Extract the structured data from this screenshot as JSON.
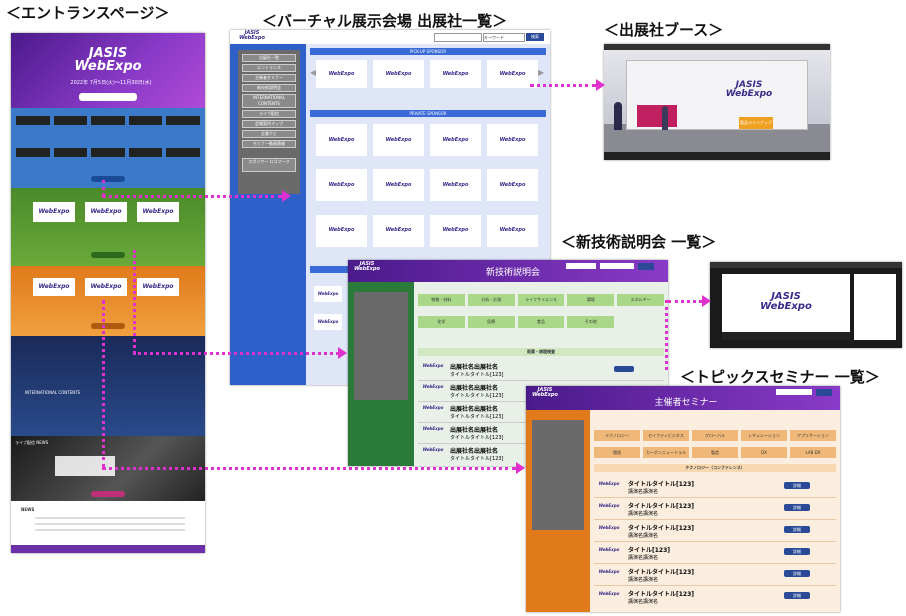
{
  "titles": {
    "entrance": "＜エントランスページ＞",
    "venue": "＜バーチャル展示会場 出展社一覧＞",
    "booth": "＜出展社ブース＞",
    "tech": "＜新技術説明会 一覧＞",
    "topics": "＜トピックスセミナー 一覧＞"
  },
  "brand": {
    "line1": "JASIS",
    "line2": "WebExpo"
  },
  "entrance": {
    "dates": "2022年 7月5日(火)～11月30日(水)",
    "news_heading": "NEWS",
    "life_heading": "ライブ配信 NEWS",
    "intl_heading": "INTERNATIONAL CONTENTS",
    "seminar_heading": "新技術説明会",
    "company": "出展社名",
    "colors": {
      "hero": "#6b2fa8",
      "blue": "#2f6fb8",
      "green": "#5a9a2e",
      "orange": "#e08a2a",
      "dark": "#2a2a3a"
    }
  },
  "venue": {
    "search_placeholder": "キーワード",
    "search_btn": "検索",
    "pickup_label": "PICK-UP SPONSOR",
    "private_label": "PRIVATE SPONSOR",
    "menu": [
      "出展社一覧",
      "エントランス",
      "主催者セミナー",
      "新技術説明会",
      "INTERNATIONAL CONTENTS",
      "ライブ配信",
      "会場案内マップ",
      "企業ナビ",
      "セミナー動画情報"
    ],
    "sponsor_label": "スポンサー ロゴマーク",
    "card_caption": "JASIS Web Expo"
  },
  "booth": {
    "sign": "出展社名",
    "panel": "製品ラインナップ"
  },
  "tech": {
    "header": "新技術説明会",
    "categories": [
      "物質・材料",
      "分析・計測",
      "ライフサイエンス",
      "環境",
      "エネルギー",
      "化学",
      "医療",
      "食品",
      "その他"
    ],
    "section": "医薬・病理検査",
    "items": [
      {
        "name": "出展社名出展社名",
        "title": "タイトルタイトル[123]"
      },
      {
        "name": "出展社名出展社名",
        "title": "タイトルタイトル[123]"
      },
      {
        "name": "出展社名出展社名",
        "title": "タイトルタイトル[123]"
      },
      {
        "name": "出展社名出展社名",
        "title": "タイトルタイトル[123]"
      },
      {
        "name": "出展社名出展社名",
        "title": "タイトルタイトル[123]"
      }
    ]
  },
  "topics": {
    "header": "主催者セミナー",
    "categories": [
      "テクノロジー",
      "セイフティビジネス",
      "グローバル",
      "レギュレーション",
      "アプリケーション",
      "環境",
      "カーボンニュートラル",
      "製造",
      "DX",
      "LAB DX"
    ],
    "section": "テクノロジー（コンファレンス）",
    "items": [
      {
        "title": "タイトルタイトル[123]",
        "sub": "講演名講演名"
      },
      {
        "title": "タイトルタイトル[123]",
        "sub": "講演名講演名"
      },
      {
        "title": "タイトルタイトル[123]",
        "sub": "講演名講演名"
      },
      {
        "title": "タイトル[123]",
        "sub": "講演名講演名"
      },
      {
        "title": "タイトルタイトル[123]",
        "sub": "講演名講演名"
      },
      {
        "title": "タイトルタイトル[123]",
        "sub": "講演名講演名"
      }
    ],
    "detail_btn": "詳細"
  }
}
